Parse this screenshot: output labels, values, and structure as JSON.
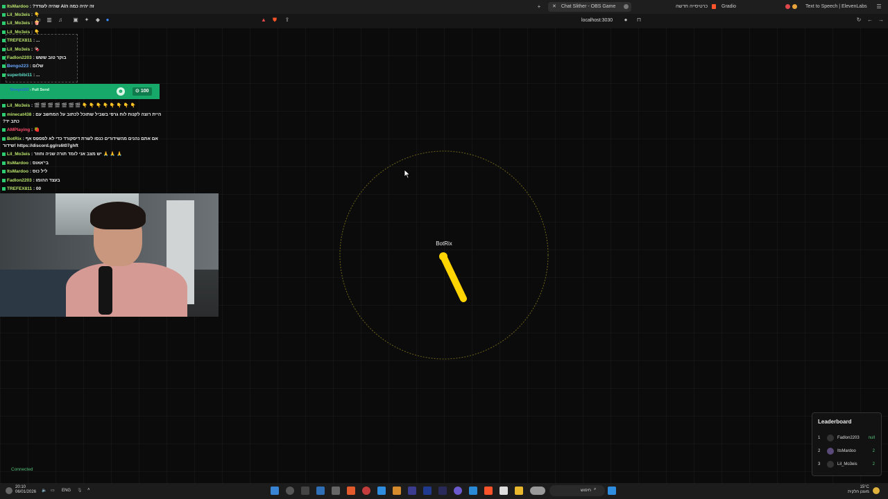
{
  "browser": {
    "tabs": [
      {
        "label": "Chat Slither - OBS Game",
        "active": true
      },
      {
        "label": "כרטיסייה חדשה",
        "active": false
      },
      {
        "label": "Gradio",
        "active": false
      },
      {
        "label": "Text to Speech | ElevenLabs",
        "active": false
      }
    ],
    "new_tab_symbol": "+",
    "close_symbol": "✕",
    "url": "localhost:3030"
  },
  "chat": {
    "messages": [
      {
        "user": "ItsMardoo",
        "text": ": ?שהיה לעודד AIזה יהיה כמה ה"
      },
      {
        "user": "Lil_Mo3eis",
        "text": ": 👇"
      },
      {
        "user": "Lil_Mo3eis",
        "text": ": 🍿"
      },
      {
        "user": "Lil_Mo3eis",
        "text": ": 👇"
      },
      {
        "user": "TREFEX811",
        "text": ": ..."
      },
      {
        "user": "Lil_Mo3eis",
        "text": ": 🍫"
      },
      {
        "user": "Fadlon2203",
        "text": ": בוקר טוב ששש"
      },
      {
        "user": "Bengo223",
        "text": ": שלום"
      },
      {
        "user": "superbibi11",
        "text": ": ..."
      },
      {
        "user": "Lil_Mo3eis",
        "text": ": 🎬 🎬 🎬 🎬 🎬 🎬 🎬 👇 👇 👇 👇 👇 👇 👇 👇"
      },
      {
        "user": "minecat438",
        "text": ": היית רוצה לקנות לוח גרפי בשביל שתוכל לכתוב על המחשב עם"
      },
      {
        "user": "",
        "text": "?כתב יד"
      },
      {
        "user": "AMPlaying",
        "text": ": 🍓"
      },
      {
        "user": "BotRix",
        "text": ": אם אתם נהנים מהשידורים כנסו לשרת דיסקורד כדי לא לפספס אף"
      },
      {
        "user": "",
        "text": "שידור! https://discord.gg/rs6t07ghft"
      },
      {
        "user": "Lil_Mo3eis",
        "text": ": יש מצב אני לומד תורה שניה וחוזר 🙏 🙏 🙏"
      },
      {
        "user": "ItsMardoo",
        "text": ": בי'אאוס"
      },
      {
        "user": "ItsMardoo",
        "text": ": ליל כוס"
      },
      {
        "user": "Fadlon2203",
        "text": ": בעצד ההומו"
      },
      {
        "user": "TREFEX811",
        "text": ": 00"
      }
    ]
  },
  "redeem": {
    "user": "Bengo223",
    "label": "- Full Send",
    "cost": "100",
    "cost_symbol": "⊙"
  },
  "game": {
    "player_name": "BotRix",
    "snake_color": "#FFD400",
    "arena_color": "#8a7a1a",
    "status": "Connected"
  },
  "leaderboard": {
    "title": "Leaderboard",
    "rows": [
      {
        "rank": "1",
        "name": "Fadlon2203",
        "score": "null"
      },
      {
        "rank": "2",
        "name": "ItsMardoo",
        "score": "2"
      },
      {
        "rank": "3",
        "name": "Lil_Mo3eis",
        "score": "2"
      }
    ]
  },
  "taskbar": {
    "time": "20:10",
    "date": "06/01/2026",
    "lang": "ENG",
    "search_placeholder": "חיפוש",
    "weather_temp": "15°C",
    "weather_desc": "מעונן חלקית"
  }
}
